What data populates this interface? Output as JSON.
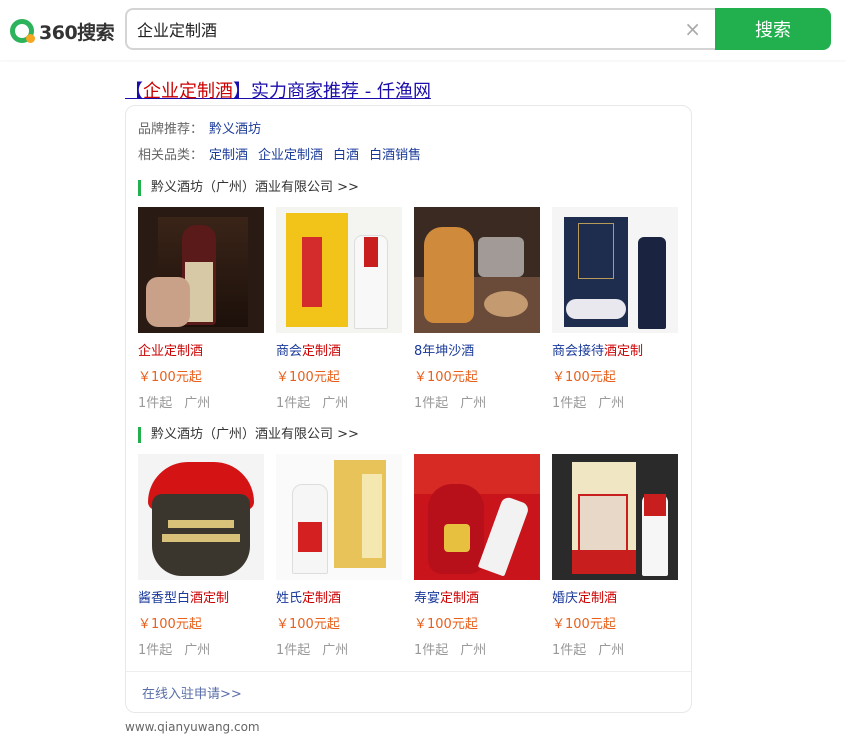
{
  "header": {
    "logo_text": "360搜索",
    "search_value": "企业定制酒",
    "clear_glyph": "×",
    "search_button": "搜索"
  },
  "result": {
    "title_bracket_open": "【",
    "title_keyword": "企业定制酒",
    "title_rest": "】实力商家推荐 - 仟渔网",
    "brand_label": "品牌推荐：",
    "brand_link": "黔义酒坊",
    "related_label": "相关品类：",
    "related_links": [
      "定制酒",
      "企业定制酒",
      "白酒",
      "白酒销售"
    ],
    "groups": [
      {
        "company": "黔义酒坊（广州）酒业有限公司 >>",
        "products": [
          {
            "name_blue": "",
            "name_red": "企业定制酒",
            "price": "￥100元起",
            "min": "1件起",
            "city": "广州"
          },
          {
            "name_blue": "商会",
            "name_red": "定制酒",
            "price": "￥100元起",
            "min": "1件起",
            "city": "广州"
          },
          {
            "name_blue": "8年坤沙酒",
            "name_red": "",
            "price": "￥100元起",
            "min": "1件起",
            "city": "广州"
          },
          {
            "name_blue": "商会接待",
            "name_red": "酒定制",
            "price": "￥100元起",
            "min": "1件起",
            "city": "广州"
          }
        ]
      },
      {
        "company": "黔义酒坊（广州）酒业有限公司 >>",
        "products": [
          {
            "name_blue": "酱香型白",
            "name_red": "酒定制",
            "price": "￥100元起",
            "min": "1件起",
            "city": "广州"
          },
          {
            "name_blue": "姓氏",
            "name_red": "定制酒",
            "price": "￥100元起",
            "min": "1件起",
            "city": "广州"
          },
          {
            "name_blue": "寿宴",
            "name_red": "定制酒",
            "price": "￥100元起",
            "min": "1件起",
            "city": "广州"
          },
          {
            "name_blue": "婚庆",
            "name_red": "定制酒",
            "price": "￥100元起",
            "min": "1件起",
            "city": "广州"
          }
        ]
      }
    ],
    "apply_link": "在线入驻申请>>",
    "source_url": "www.qianyuwang.com"
  },
  "colors": {
    "brand_green": "#21b04d",
    "link_blue": "#1a0dab",
    "keyword_red": "#cc0000",
    "price_orange": "#e8601c"
  }
}
